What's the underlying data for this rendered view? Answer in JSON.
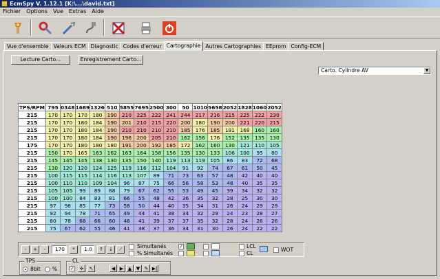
{
  "window": {
    "title": "EcmSpy V. 1.12.1  [K:\\...\\david.txt]"
  },
  "menu": [
    "Fichier",
    "Options",
    "Vue",
    "Extras",
    "Aide"
  ],
  "toolbar": [
    "wizard-icon",
    "tools-icon",
    "wrench-icon",
    "plug-icon",
    "flag-icon",
    "printer-icon",
    "power-icon"
  ],
  "tabs": [
    "Vue d'ensemble",
    "Valeurs ECM",
    "Diagnostic",
    "Codes d'erreur",
    "Cartographie",
    "Autres Cartographies",
    "EEprom",
    "Config-ECM"
  ],
  "active_tab": "Cartographie",
  "buttons": {
    "read": "Lecture Carto...",
    "write": "Enregistrement Carto..."
  },
  "map_select": {
    "value": "Carto. Cylindre AV"
  },
  "grid": {
    "corner": "TPS/RPM",
    "columns": [
      "795",
      "0348",
      "1689",
      "1326",
      "510",
      "5855",
      "7695",
      "2500",
      "300",
      "50",
      "1010",
      "5658",
      "2052",
      "1828",
      "1060",
      "2052"
    ],
    "rows": [
      {
        "tps": "215",
        "cells": [
          "170",
          "170",
          "170",
          "180",
          "190",
          "210",
          "225",
          "222",
          "241",
          "244",
          "217",
          "216",
          "215",
          "225",
          "222",
          "230"
        ]
      },
      {
        "tps": "215",
        "cells": [
          "170",
          "170",
          "180",
          "184",
          "190",
          "201",
          "210",
          "215",
          "220",
          "200",
          "180",
          "190",
          "200",
          "221",
          "220",
          "215"
        ]
      },
      {
        "tps": "215",
        "cells": [
          "170",
          "170",
          "180",
          "184",
          "190",
          "210",
          "210",
          "210",
          "210",
          "185",
          "176",
          "185",
          "181",
          "168",
          "160",
          "160"
        ]
      },
      {
        "tps": "215",
        "cells": [
          "170",
          "170",
          "180",
          "184",
          "190",
          "196",
          "200",
          "205",
          "210",
          "162",
          "156",
          "176",
          "152",
          "135",
          "135",
          "130"
        ]
      },
      {
        "tps": "175",
        "cells": [
          "170",
          "170",
          "180",
          "180",
          "180",
          "191",
          "200",
          "192",
          "185",
          "172",
          "162",
          "160",
          "130",
          "121",
          "110",
          "105"
        ]
      },
      {
        "tps": "215",
        "cells": [
          "150",
          "170",
          "165",
          "163",
          "162",
          "163",
          "164",
          "158",
          "156",
          "135",
          "130",
          "133",
          "106",
          "100",
          "95",
          "80"
        ]
      },
      {
        "tps": "215",
        "cells": [
          "145",
          "145",
          "145",
          "138",
          "130",
          "135",
          "150",
          "140",
          "119",
          "113",
          "119",
          "105",
          "86",
          "83",
          "72",
          "68"
        ]
      },
      {
        "tps": "215",
        "cells": [
          "130",
          "120",
          "120",
          "124",
          "125",
          "119",
          "116",
          "112",
          "104",
          "91",
          "92",
          "74",
          "67",
          "61",
          "50",
          "45"
        ]
      },
      {
        "tps": "215",
        "cells": [
          "100",
          "115",
          "115",
          "114",
          "116",
          "113",
          "107",
          "89",
          "71",
          "73",
          "63",
          "57",
          "48",
          "42",
          "40",
          "40"
        ]
      },
      {
        "tps": "215",
        "cells": [
          "100",
          "110",
          "110",
          "109",
          "104",
          "96",
          "87",
          "75",
          "66",
          "56",
          "58",
          "53",
          "48",
          "40",
          "35",
          "35"
        ]
      },
      {
        "tps": "215",
        "cells": [
          "105",
          "105",
          "99",
          "89",
          "88",
          "79",
          "67",
          "62",
          "55",
          "53",
          "49",
          "45",
          "39",
          "34",
          "32",
          "32"
        ]
      },
      {
        "tps": "215",
        "cells": [
          "100",
          "100",
          "84",
          "83",
          "81",
          "66",
          "55",
          "48",
          "42",
          "36",
          "35",
          "32",
          "28",
          "25",
          "30",
          "30"
        ]
      },
      {
        "tps": "215",
        "cells": [
          "97",
          "98",
          "85",
          "77",
          "73",
          "58",
          "50",
          "44",
          "40",
          "35",
          "34",
          "31",
          "26",
          "24",
          "29",
          "29"
        ]
      },
      {
        "tps": "215",
        "cells": [
          "92",
          "94",
          "78",
          "71",
          "65",
          "49",
          "44",
          "41",
          "38",
          "34",
          "32",
          "29",
          "24",
          "23",
          "28",
          "27"
        ]
      },
      {
        "tps": "215",
        "cells": [
          "80",
          "78",
          "68",
          "66",
          "60",
          "48",
          "41",
          "39",
          "37",
          "37",
          "35",
          "32",
          "28",
          "24",
          "26",
          "26"
        ]
      },
      {
        "tps": "215",
        "cells": [
          "75",
          "67",
          "62",
          "55",
          "46",
          "41",
          "38",
          "37",
          "36",
          "34",
          "31",
          "30",
          "26",
          "24",
          "22",
          "22"
        ]
      }
    ]
  },
  "controls": {
    "step_value": "170",
    "factor_value": "1.0",
    "sim_label": "Simultanés",
    "sim_pct_label": "% Simultanés",
    "lcl_label": "LCL",
    "cl_label": "CL",
    "wot_label": "WOT"
  },
  "tps_group": {
    "title": "TPS",
    "opt1": "8bit",
    "opt2": "%"
  },
  "cl_group": {
    "title": "CL"
  },
  "colors": {
    "red": "#f0a0a0",
    "orange": "#f0c8a0",
    "yellow": "#f0f0a8",
    "green": "#a8f0a8",
    "teal": "#a0e8d8",
    "cyan": "#a8e0f0",
    "blue": "#a8b8f0",
    "violet": "#b8b0f0"
  }
}
